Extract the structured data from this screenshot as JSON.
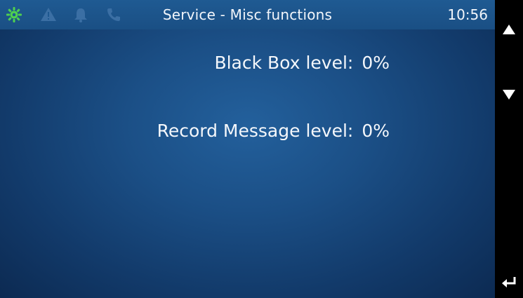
{
  "status_bar": {
    "icons": [
      "gear-icon",
      "warning-icon",
      "bell-icon",
      "phone-icon"
    ],
    "title": "Service - Misc functions",
    "time": "10:56"
  },
  "params": [
    {
      "label": "Black Box level:",
      "value": "0%"
    },
    {
      "label": "Record Message level:",
      "value": "0%"
    }
  ],
  "nav": {
    "icons": [
      "up-arrow-icon",
      "down-arrow-icon",
      "back-arrow-icon"
    ]
  },
  "colors": {
    "active_icon": "#4fd14f",
    "inactive_icon": "#3b6fa4",
    "text": "#f4f7fb",
    "background": "#1b4f86",
    "sidebar": "#000000"
  }
}
